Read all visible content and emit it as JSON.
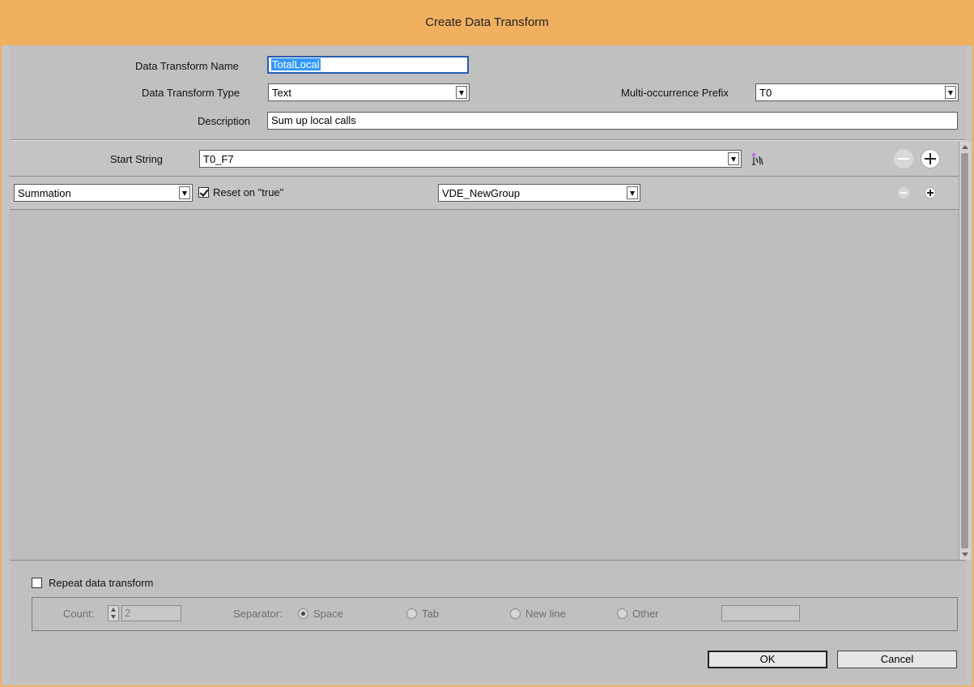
{
  "window": {
    "title": "Create Data Transform"
  },
  "form": {
    "name_label": "Data Transform Name",
    "name_value": "TotalLocal",
    "type_label": "Data Transform Type",
    "type_value": "Text",
    "prefix_label": "Multi-occurrence Prefix",
    "prefix_value": "T0",
    "description_label": "Description",
    "description_value": "Sum up local calls"
  },
  "start_string": {
    "label": "Start String",
    "value": "T0_F7",
    "insert_icon": "insert-field-icon"
  },
  "rule": {
    "operation": "Summation",
    "reset_checked": true,
    "reset_label": "Reset on \"true\"",
    "group": "VDE_NewGroup"
  },
  "repeat": {
    "checked": false,
    "label": "Repeat data transform",
    "count_label": "Count:",
    "count_value": "2",
    "separator_label": "Separator:",
    "options": [
      "Space",
      "Tab",
      "New line",
      "Other"
    ],
    "selected": "Space",
    "other_value": ""
  },
  "buttons": {
    "ok": "OK",
    "cancel": "Cancel"
  },
  "colors": {
    "titlebar": "#f0b060",
    "focus": "#2a5db0",
    "selection": "#3399ff"
  }
}
